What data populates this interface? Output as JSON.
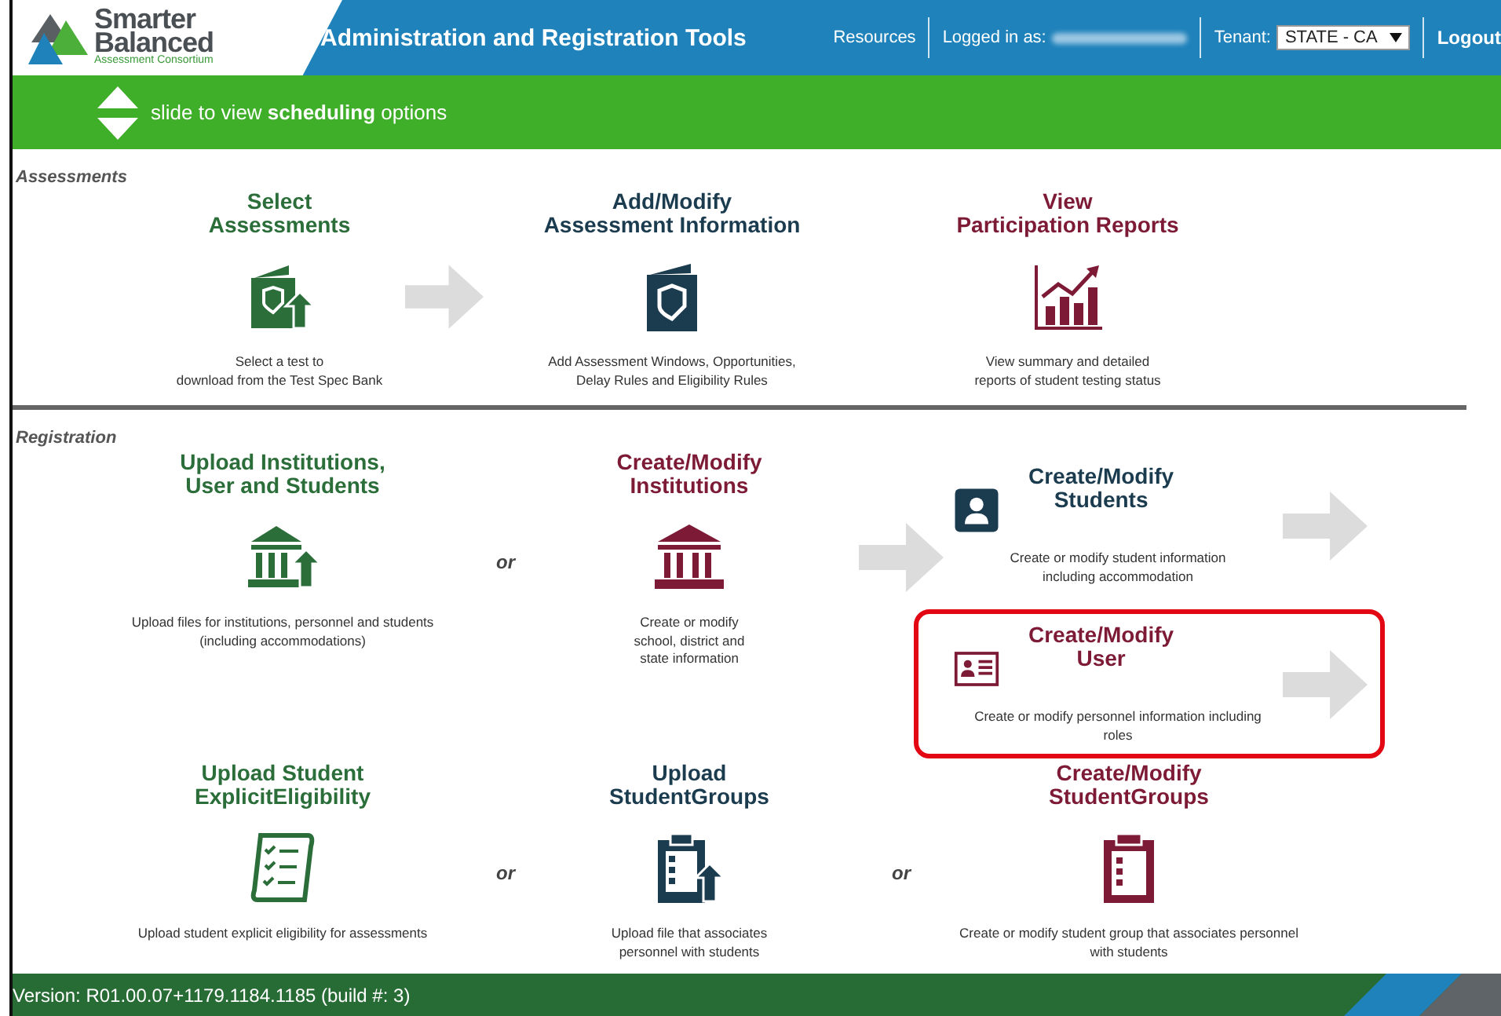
{
  "header": {
    "logo": {
      "line1": "Smarter",
      "line2": "Balanced",
      "tagline": "Assessment Consortium"
    },
    "title": "Administration and Registration Tools",
    "resources": "Resources",
    "logged_in_label": "Logged in as:",
    "tenant_label": "Tenant:",
    "tenant_value": "STATE - CA",
    "logout": "Logout"
  },
  "slide_bar": {
    "text": "slide to view **scheduling** options"
  },
  "sections": [
    {
      "title": "Assessments",
      "rows": [
        [
          {
            "kind": "tile",
            "title": "Select\nAssessments",
            "description": "Select a test to\ndownload from the Test Spec Bank",
            "color": "#2b6e3a"
          },
          {
            "kind": "arrow"
          },
          {
            "kind": "tile",
            "title": "Add/Modify\nAssessment Information",
            "description": "Add Assessment Windows, Opportunities,\nDelay Rules and Eligibility Rules",
            "color": "#1b3b4f"
          },
          {
            "kind": "tile",
            "title": "View\nParticipation Reports",
            "description": "View summary and detailed\nreports of student testing status",
            "color": "#7d1a35"
          }
        ]
      ]
    },
    {
      "title": "Registration",
      "rows": [
        [
          {
            "kind": "tile",
            "title": "Upload Institutions,\nUser and Students",
            "description": "Upload files for institutions, personnel and students\n(including accommodations)",
            "color": "#2b6e3a"
          },
          {
            "kind": "or",
            "text": "or"
          },
          {
            "kind": "tile",
            "title": "Create/Modify\nInstitutions",
            "description": "Create or modify\nschool, district and\nstate information",
            "color": "#7d1a35"
          },
          {
            "kind": "arrow"
          },
          {
            "kind": "stack",
            "tiles": [
              {
                "title": "Create/Modify\nStudents",
                "description": "Create or modify student information\nincluding accommodation",
                "color": "#1b3b4f",
                "arrow": true,
                "highlighted": false
              },
              {
                "title": "Create/Modify\nUser",
                "description": "Create or modify personnel information including\nroles",
                "color": "#7d1a35",
                "arrow": true,
                "highlighted": true
              }
            ]
          }
        ],
        [
          {
            "kind": "tile",
            "title": "Upload Student\nExplicitEligibility",
            "description": "Upload student explicit eligibility for assessments",
            "color": "#2b6e3a"
          },
          {
            "kind": "or",
            "text": "or"
          },
          {
            "kind": "tile",
            "title": "Upload\nStudentGroups",
            "description": "Upload file that associates\npersonnel with students",
            "color": "#1b3b4f"
          },
          {
            "kind": "or",
            "text": "or"
          },
          {
            "kind": "tile",
            "title": "Create/Modify\nStudentGroups",
            "description": "Create or modify student group that associates personnel\nwith students",
            "color": "#7d1a35"
          }
        ]
      ]
    }
  ],
  "footer": {
    "version": "Version: R01.00.07+1179.1184.1185 (build #: 3)"
  }
}
